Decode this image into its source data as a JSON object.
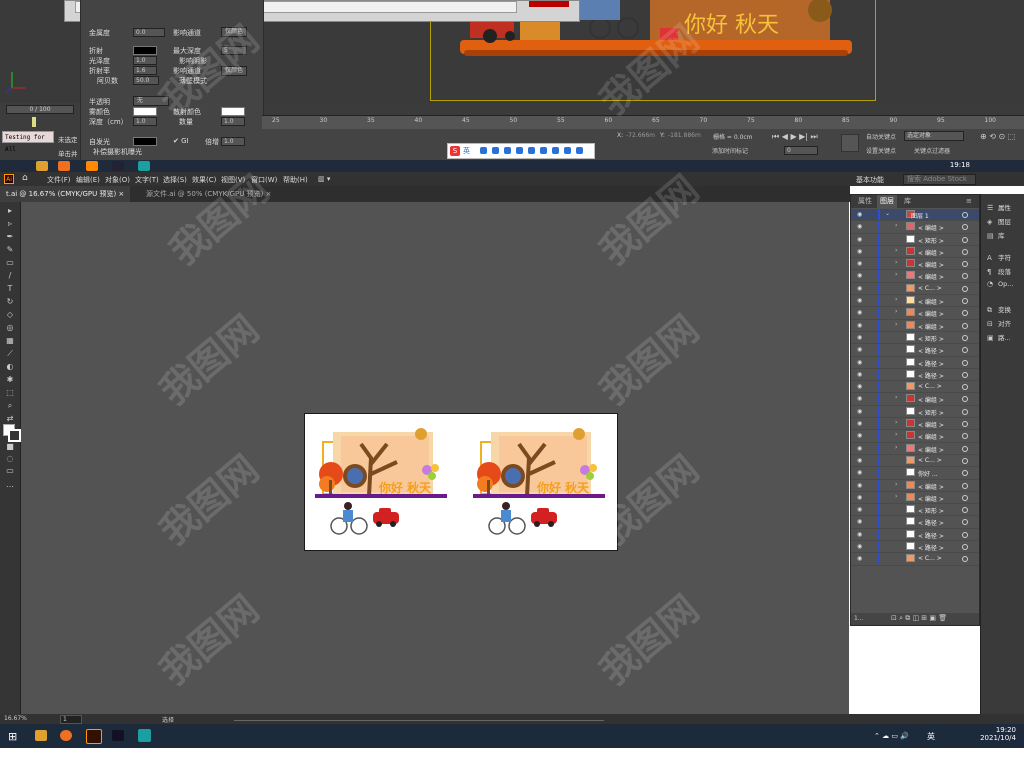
{
  "max": {
    "material_rows": [
      {
        "label": "金属度",
        "value": "0.0"
      },
      {
        "label": "折射",
        "value": ""
      },
      {
        "label": "光泽度",
        "value": "1.0"
      },
      {
        "label": "折射率",
        "value": "1.6"
      },
      {
        "label": "阿贝数",
        "value": "50.0"
      },
      {
        "label": "半透明",
        "value": "无"
      },
      {
        "label": "雾颜色",
        "value": ""
      },
      {
        "label": "深度（cm）",
        "value": "1.0"
      },
      {
        "label": "自发光",
        "value": ""
      }
    ],
    "right_labels": {
      "affect_channel": "影响通道",
      "color_only": "仅颜色",
      "max_depth": "最大深度",
      "max_depth_value": "5",
      "affect_shadow": "影响阴影",
      "affect_channel2": "影响通道",
      "color_only2": "仅颜色",
      "thin_mode": "薄壁模式",
      "scatter_color": "散射颜色",
      "amount": "数量",
      "amount_value": "1.0",
      "gi": "GI",
      "compensate": "补偿摄影机曝光",
      "multiply": "倍增",
      "multiply_value": "1.0"
    },
    "frame_counter": "0 / 100",
    "left_labels": {
      "unselected": "未选定",
      "click": "单击并"
    },
    "testing_text": "Testing for All",
    "ruler_ticks": [
      "25",
      "30",
      "35",
      "40",
      "45",
      "50",
      "55",
      "60",
      "65",
      "70",
      "75",
      "80",
      "85",
      "90",
      "95",
      "100"
    ],
    "status": {
      "x_label": "X:",
      "x_value": "-72.666m",
      "y_label": "Y:",
      "y_value": "-181.886m",
      "grid": "栅格 = 0.0cm",
      "add_tag": "添加时间标记",
      "auto_key": "自动关键点",
      "selected_obj": "选定对象",
      "set_key": "设置关键点",
      "key_filter": "关键点过滤器",
      "frame_value": "0"
    },
    "ime": {
      "char": "S",
      "label": "英"
    },
    "clock": "19:18",
    "scene_text": "你好 秋天"
  },
  "ai": {
    "logo": "Ai",
    "menu": [
      "文件(F)",
      "编辑(E)",
      "对象(O)",
      "文字(T)",
      "选择(S)",
      "效果(C)",
      "视图(V)",
      "窗口(W)",
      "帮助(H)"
    ],
    "workspace": "基本功能",
    "search_placeholder": "搜索 Adobe Stock",
    "tabs": [
      {
        "label": "t.ai @ 16.67% (CMYK/GPU 预览)"
      },
      {
        "label": "源文件.ai @ 50% (CMYK/GPU 预览)"
      }
    ],
    "artwork_text": "你好 秋天",
    "layers_tabs": [
      "属性",
      "图层",
      "库"
    ],
    "layers": [
      {
        "name": "图层 1",
        "arrow": "⌄",
        "thumb": "#c44"
      },
      {
        "name": "< 编组 >",
        "arrow": "›",
        "thumb": "#d66"
      },
      {
        "name": "< 矩形 >",
        "arrow": "",
        "thumb": "#fff"
      },
      {
        "name": "< 编组 >",
        "arrow": "›",
        "thumb": "#c33"
      },
      {
        "name": "< 编组 >",
        "arrow": "›",
        "thumb": "#c33"
      },
      {
        "name": "< 编组 >",
        "arrow": "›",
        "thumb": "#e77"
      },
      {
        "name": "< C... >",
        "arrow": "",
        "thumb": "#e96"
      },
      {
        "name": "< 编组 >",
        "arrow": "›",
        "thumb": "#fd9"
      },
      {
        "name": "< 编组 >",
        "arrow": "›",
        "thumb": "#e85"
      },
      {
        "name": "< 编组 >",
        "arrow": "›",
        "thumb": "#e85"
      },
      {
        "name": "< 矩形 >",
        "arrow": "",
        "thumb": "#fff"
      },
      {
        "name": "< 路径 >",
        "arrow": "",
        "thumb": "#fff"
      },
      {
        "name": "< 路径 >",
        "arrow": "",
        "thumb": "#fff"
      },
      {
        "name": "< 路径 >",
        "arrow": "",
        "thumb": "#fff"
      },
      {
        "name": "< C... >",
        "arrow": "",
        "thumb": "#e96"
      },
      {
        "name": "< 编组 >",
        "arrow": "›",
        "thumb": "#c33"
      },
      {
        "name": "< 矩形 >",
        "arrow": "",
        "thumb": "#fff"
      },
      {
        "name": "< 编组 >",
        "arrow": "›",
        "thumb": "#c33"
      },
      {
        "name": "< 编组 >",
        "arrow": "›",
        "thumb": "#c33"
      },
      {
        "name": "< 编组 >",
        "arrow": "›",
        "thumb": "#e77"
      },
      {
        "name": "< C... >",
        "arrow": "",
        "thumb": "#e96"
      },
      {
        "name": "你好 ...",
        "arrow": "",
        "thumb": "#fff"
      },
      {
        "name": "< 编组 >",
        "arrow": "›",
        "thumb": "#e85"
      },
      {
        "name": "< 编组 >",
        "arrow": "›",
        "thumb": "#e85"
      },
      {
        "name": "< 矩形 >",
        "arrow": "",
        "thumb": "#fff"
      },
      {
        "name": "< 路径 >",
        "arrow": "",
        "thumb": "#fff"
      },
      {
        "name": "< 路径 >",
        "arrow": "",
        "thumb": "#fff"
      },
      {
        "name": "< 路径 >",
        "arrow": "",
        "thumb": "#fff"
      },
      {
        "name": "< C... >",
        "arrow": "",
        "thumb": "#e96"
      }
    ],
    "layers_footer": "1...",
    "dock": [
      {
        "icon": "☰",
        "label": "属性"
      },
      {
        "icon": "◈",
        "label": "图层"
      },
      {
        "icon": "▤",
        "label": "库"
      },
      {
        "icon": "A",
        "label": "字符"
      },
      {
        "icon": "¶",
        "label": "段落"
      },
      {
        "icon": "◔",
        "label": "Op..."
      },
      {
        "icon": "⧉",
        "label": "变换"
      },
      {
        "icon": "⊟",
        "label": "对齐"
      },
      {
        "icon": "▣",
        "label": "路..."
      }
    ],
    "status": {
      "zoom": "16.67%",
      "page": "1",
      "mode": "选择"
    }
  },
  "taskbar": {
    "time": "19:20",
    "date": "2021/10/4",
    "lang": "英"
  },
  "watermark": "我图网"
}
